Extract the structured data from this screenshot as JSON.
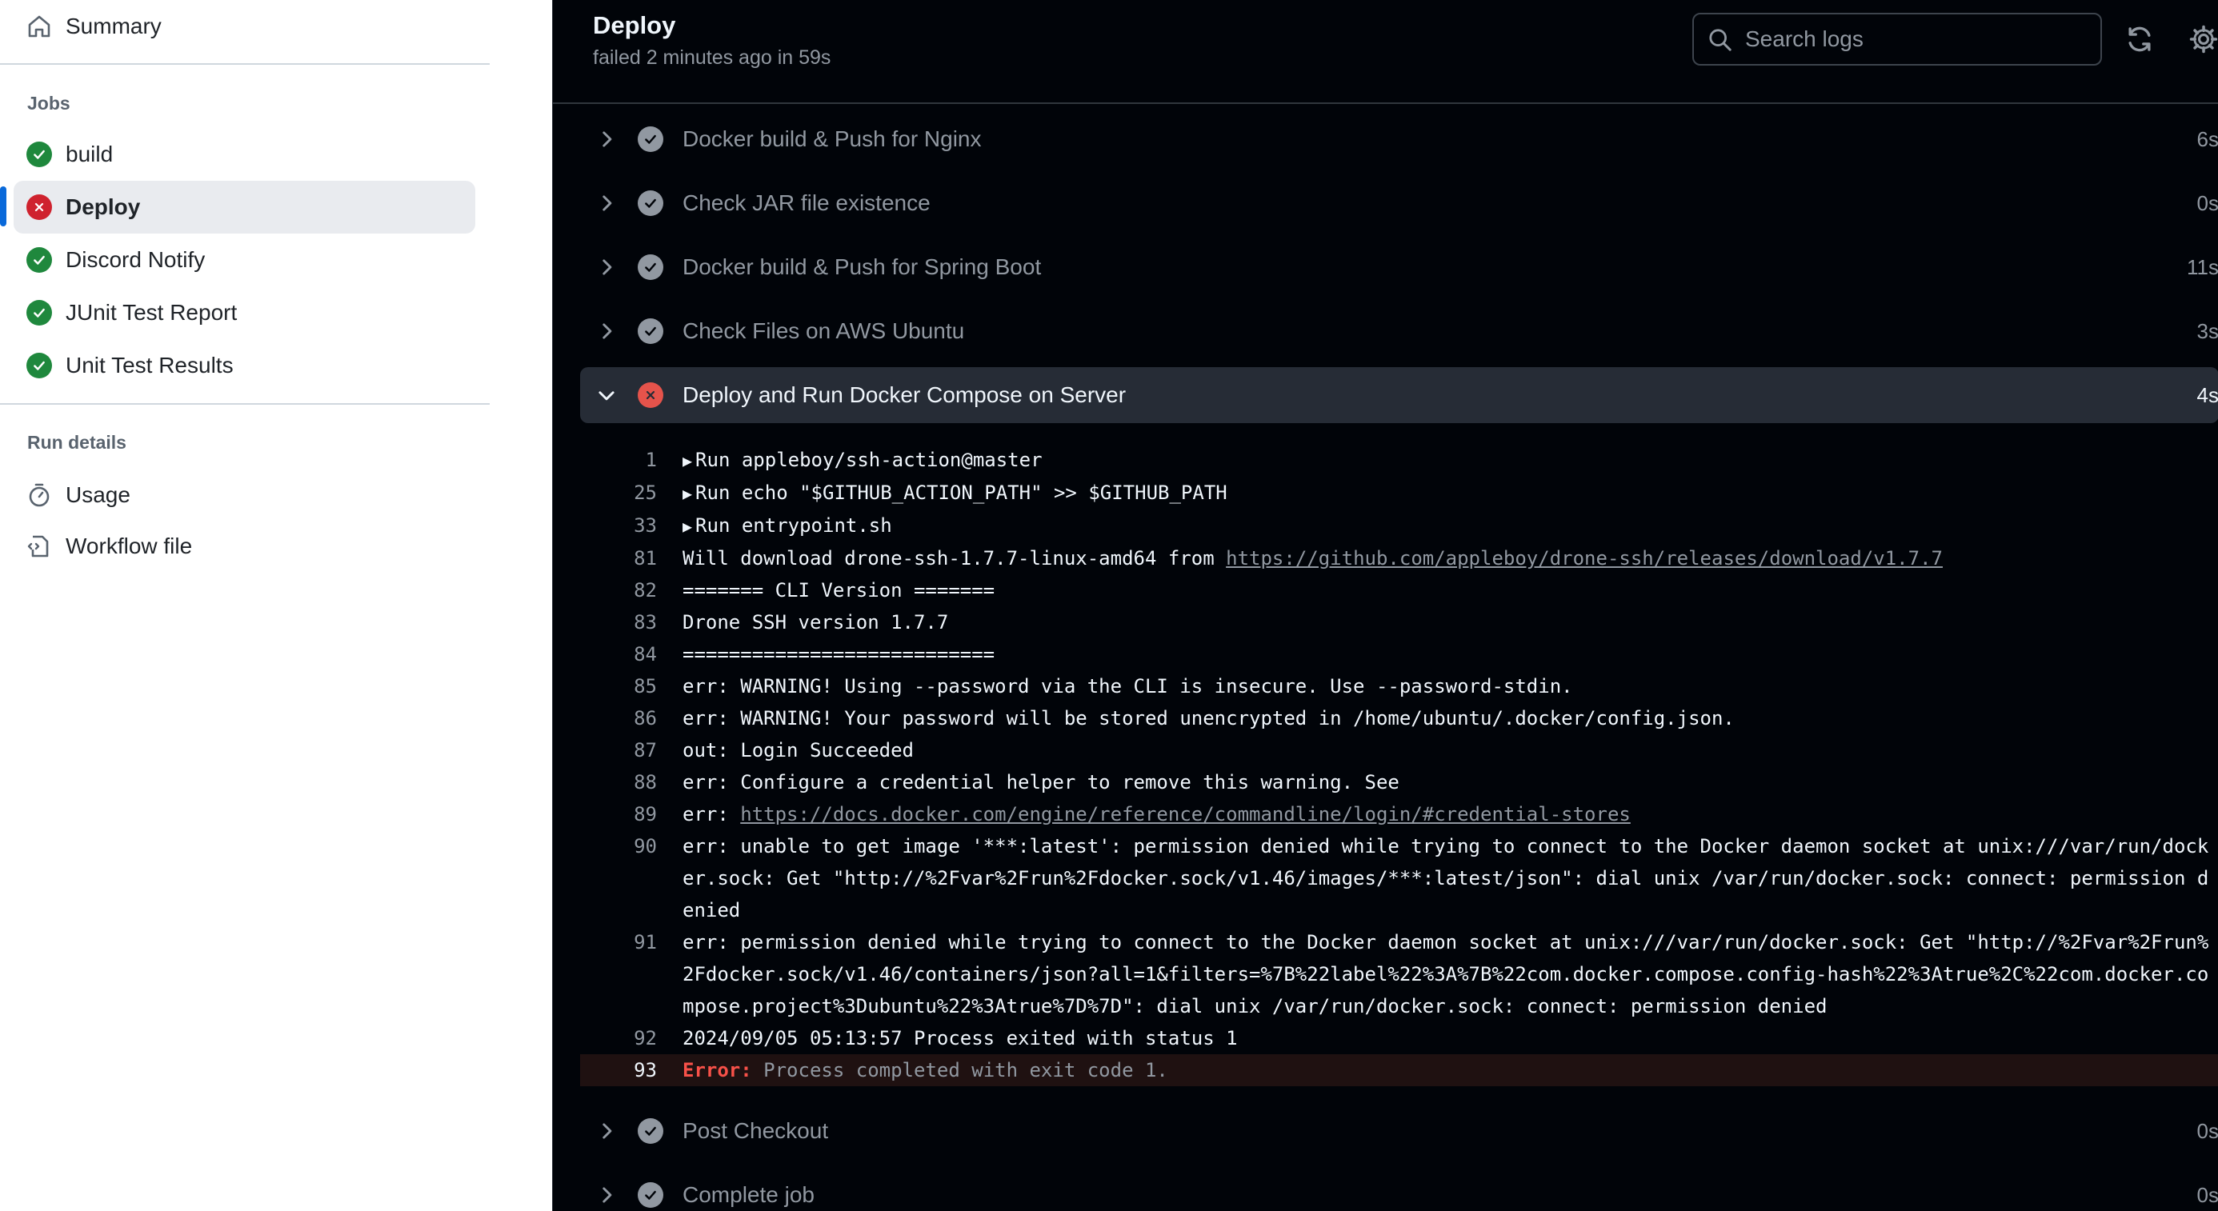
{
  "sidebar": {
    "summary_label": "Summary",
    "jobs_heading": "Jobs",
    "jobs": [
      {
        "label": "build",
        "status": "success"
      },
      {
        "label": "Deploy",
        "status": "failure"
      },
      {
        "label": "Discord Notify",
        "status": "success"
      },
      {
        "label": "JUnit Test Report",
        "status": "success"
      },
      {
        "label": "Unit Test Results",
        "status": "success"
      }
    ],
    "run_details_heading": "Run details",
    "usage_label": "Usage",
    "workflow_file_label": "Workflow file"
  },
  "header": {
    "title": "Deploy",
    "subtitle": "failed 2 minutes ago in 59s",
    "search_placeholder": "Search logs"
  },
  "steps_before": [
    {
      "label": "Docker build & Push for Nginx",
      "time": "6s"
    },
    {
      "label": "Check JAR file existence",
      "time": "0s"
    },
    {
      "label": "Docker build & Push for Spring Boot",
      "time": "11s"
    },
    {
      "label": "Check Files on AWS Ubuntu",
      "time": "3s"
    }
  ],
  "expanded_step": {
    "label": "Deploy and Run Docker Compose on Server",
    "time": "4s"
  },
  "log_lines": [
    {
      "num": "1",
      "text": "Run appleboy/ssh-action@master"
    },
    {
      "num": "25",
      "text": "Run echo \"$GITHUB_ACTION_PATH\" >> $GITHUB_PATH"
    },
    {
      "num": "33",
      "text": "Run entrypoint.sh"
    },
    {
      "num": "81",
      "text": "Will download drone-ssh-1.7.7-linux-amd64 from ",
      "link": "https://github.com/appleboy/drone-ssh/releases/download/v1.7.7"
    },
    {
      "num": "82",
      "text": "======= CLI Version ======="
    },
    {
      "num": "83",
      "text": "Drone SSH version 1.7.7"
    },
    {
      "num": "84",
      "text": "==========================="
    },
    {
      "num": "85",
      "text": "err: WARNING! Using --password via the CLI is insecure. Use --password-stdin."
    },
    {
      "num": "86",
      "text": "err: WARNING! Your password will be stored unencrypted in /home/ubuntu/.docker/config.json."
    },
    {
      "num": "87",
      "text": "out: Login Succeeded"
    },
    {
      "num": "88",
      "text": "err: Configure a credential helper to remove this warning. See"
    },
    {
      "num": "89",
      "text": "err: ",
      "link": "https://docs.docker.com/engine/reference/commandline/login/#credential-stores"
    },
    {
      "num": "90",
      "text": "err: unable to get image '***:latest': permission denied while trying to connect to the Docker daemon socket at unix:///var/run/docker.sock: Get \"http://%2Fvar%2Frun%2Fdocker.sock/v1.46/images/***:latest/json\": dial unix /var/run/docker.sock: connect: permission denied"
    },
    {
      "num": "91",
      "text": "err: permission denied while trying to connect to the Docker daemon socket at unix:///var/run/docker.sock: Get \"http://%2Fvar%2Frun%2Fdocker.sock/v1.46/containers/json?all=1&filters=%7B%22label%22%3A%7B%22com.docker.compose.config-hash%22%3Atrue%2C%22com.docker.compose.project%3Dubuntu%22%3Atrue%7D%7D\": dial unix /var/run/docker.sock: connect: permission denied"
    },
    {
      "num": "92",
      "text": "2024/09/05 05:13:57 Process exited with status 1"
    }
  ],
  "error_line": {
    "num": "93",
    "keyword": "Error:",
    "message": " Process completed with exit code 1."
  },
  "steps_after": [
    {
      "label": "Post Checkout",
      "time": "0s"
    },
    {
      "label": "Complete job",
      "time": "0s"
    }
  ]
}
